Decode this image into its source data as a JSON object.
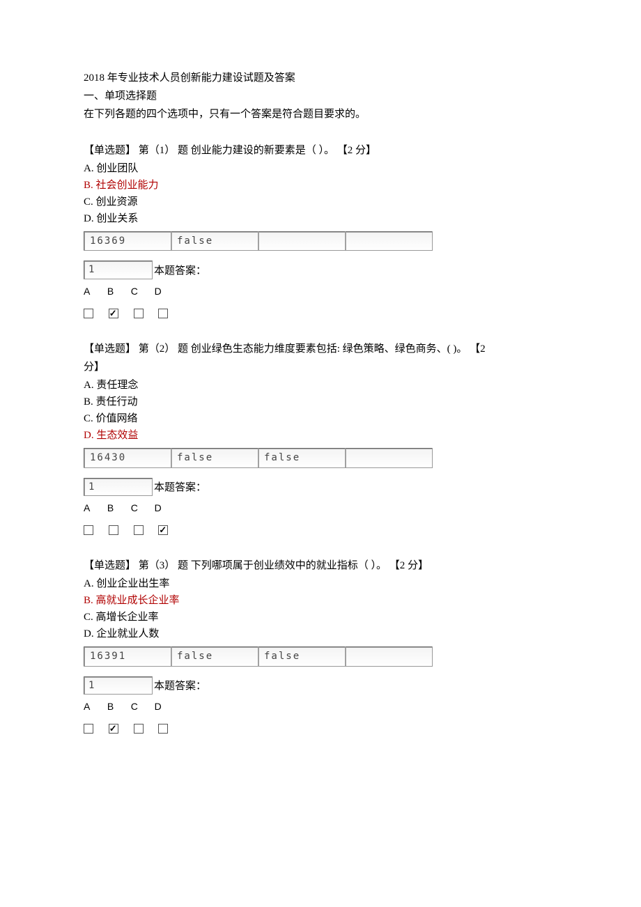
{
  "header": {
    "title": "2018 年专业技术人员创新能力建设试题及答案",
    "section": "一、单项选择题",
    "instruction": "在下列各题的四个选项中，只有一个答案是符合题目要求的。"
  },
  "questions": [
    {
      "prompt": "【单选题】 第（1）  题  创业能力建设的新要素是（  ）。 【2 分】",
      "options": [
        {
          "label": "A.  创业团队",
          "is_answer": false
        },
        {
          "label": "B.  社会创业能力",
          "is_answer": true
        },
        {
          "label": "C.  创业资源",
          "is_answer": false
        },
        {
          "label": "D.  创业关系",
          "is_answer": false
        }
      ],
      "table": [
        "16369",
        "false",
        "",
        ""
      ],
      "seq": "1",
      "answer_label": "本题答案：",
      "choices_header": [
        "A",
        "B",
        "C",
        "D"
      ],
      "checked_index": 1
    },
    {
      "prompt_line1": "【单选题】 第（2）  题  创业绿色生态能力维度要素包括: 绿色策略、绿色商务、(   )。 【2",
      "prompt_line2": "分】",
      "options": [
        {
          "label": "A.  责任理念",
          "is_answer": false
        },
        {
          "label": "B.  责任行动",
          "is_answer": false
        },
        {
          "label": "C.  价值网络",
          "is_answer": false
        },
        {
          "label": "D.  生态效益",
          "is_answer": true
        }
      ],
      "table": [
        "16430",
        "false",
        "false",
        ""
      ],
      "seq": "1",
      "answer_label": "本题答案：",
      "choices_header": [
        "A",
        "B",
        "C",
        "D"
      ],
      "checked_index": 3
    },
    {
      "prompt": "【单选题】 第（3）  题  下列哪项属于创业绩效中的就业指标（  ）。 【2 分】",
      "options": [
        {
          "label": "A.  创业企业出生率",
          "is_answer": false
        },
        {
          "label": "B.  高就业成长企业率",
          "is_answer": true
        },
        {
          "label": "C.  高增长企业率",
          "is_answer": false
        },
        {
          "label": "D.  企业就业人数",
          "is_answer": false
        }
      ],
      "table": [
        "16391",
        "false",
        "false",
        ""
      ],
      "seq": "1",
      "answer_label": "本题答案：",
      "choices_header": [
        "A",
        "B",
        "C",
        "D"
      ],
      "checked_index": 1
    }
  ]
}
